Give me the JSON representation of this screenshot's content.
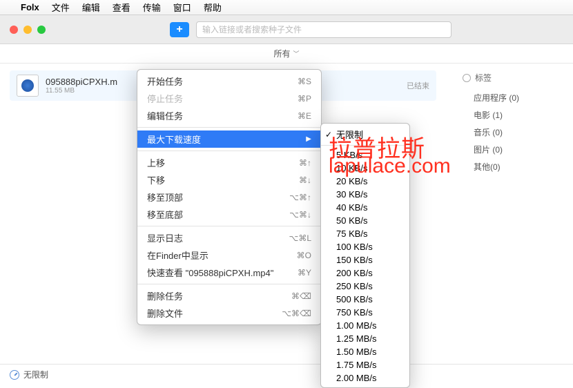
{
  "menubar": {
    "app": "Folx",
    "items": [
      "文件",
      "编辑",
      "查看",
      "传输",
      "窗口",
      "帮助"
    ]
  },
  "toolbar": {
    "search_placeholder": "输入链接或者搜索种子文件"
  },
  "filter": {
    "label": "所有"
  },
  "download": {
    "name": "095888piCPXH.m",
    "size": "11.55 MB",
    "status": "已结束"
  },
  "sidebar": {
    "heading": "标签",
    "items": [
      "应用程序 (0)",
      "电影 (1)",
      "音乐 (0)",
      "图片 (0)",
      "其他(0)"
    ]
  },
  "context_menu": {
    "groups": [
      [
        {
          "label": "开始任务",
          "sc": "⌘S"
        },
        {
          "label": "停止任务",
          "sc": "⌘P",
          "disabled": true
        },
        {
          "label": "编辑任务",
          "sc": "⌘E"
        }
      ],
      [
        {
          "label": "最大下载速度",
          "submenu": true,
          "hl": true
        }
      ],
      [
        {
          "label": "上移",
          "sc": "⌘↑"
        },
        {
          "label": "下移",
          "sc": "⌘↓"
        },
        {
          "label": "移至顶部",
          "sc": "⌥⌘↑"
        },
        {
          "label": "移至底部",
          "sc": "⌥⌘↓"
        }
      ],
      [
        {
          "label": "显示日志",
          "sc": "⌥⌘L"
        },
        {
          "label": "在Finder中显示",
          "sc": "⌘O"
        },
        {
          "label": "快速查看 \"095888piCPXH.mp4\"",
          "sc": "⌘Y"
        }
      ],
      [
        {
          "label": "删除任务",
          "sc": "⌘⌫"
        },
        {
          "label": "删除文件",
          "sc": "⌥⌘⌫"
        }
      ]
    ]
  },
  "submenu": {
    "checked": "无限制",
    "items": [
      "无限制",
      "5 KB/s",
      "10 KB/s",
      "20 KB/s",
      "30 KB/s",
      "40 KB/s",
      "50 KB/s",
      "75 KB/s",
      "100 KB/s",
      "150 KB/s",
      "200 KB/s",
      "250 KB/s",
      "500 KB/s",
      "750 KB/s",
      "1.00 MB/s",
      "1.25 MB/s",
      "1.50 MB/s",
      "1.75 MB/s",
      "2.00 MB/s"
    ]
  },
  "footer": {
    "speed": "无限制"
  },
  "watermark": {
    "line1": "拉普拉斯",
    "line2": "lapulace.com"
  }
}
